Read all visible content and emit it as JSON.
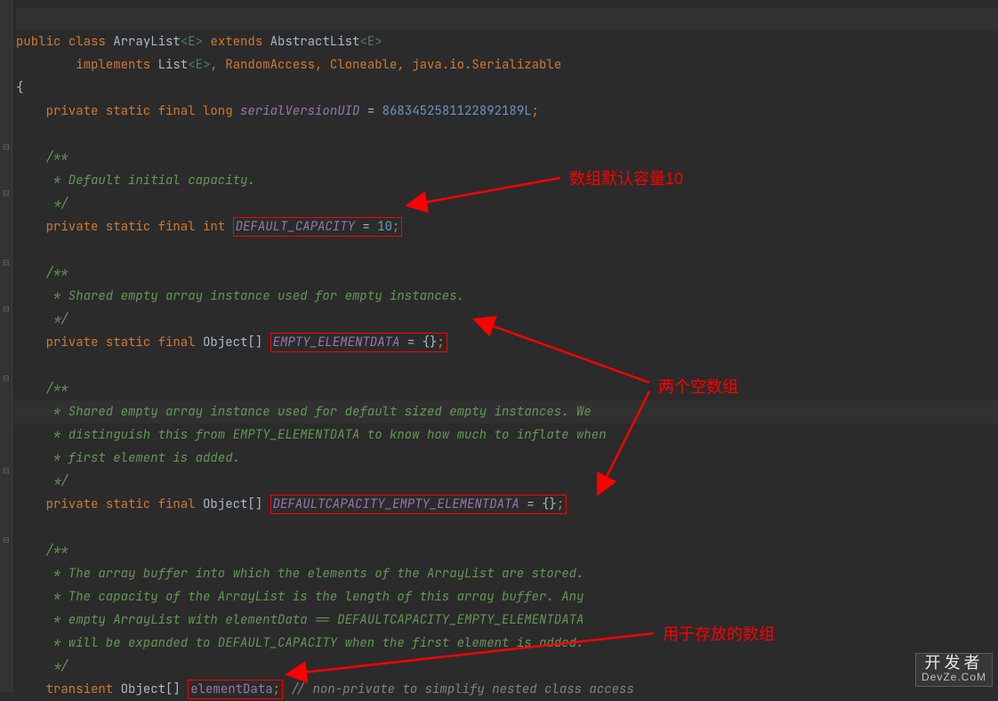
{
  "code": {
    "line1_public": "public",
    "line1_class": "class",
    "line1_name": "ArrayList",
    "line1_gen1": "<E>",
    "line1_extends": "extends",
    "line1_super": "AbstractList",
    "line1_gen2": "<E>",
    "line2_impl": "implements",
    "line2_list": "List",
    "line2_gen": "<E>",
    "line2_rest": ", RandomAccess, Cloneable, java.io.Serializable",
    "line3": "{",
    "line4_mods": "private static final long",
    "line4_name": "serialVersionUID",
    "line4_eq": " = ",
    "line4_val": "8683452581122892189L",
    "line4_semi": ";",
    "c1_open": "/**",
    "c1_body": " * Default initial capacity.",
    "c1_close": " */",
    "line_dc_mods": "private static final int",
    "line_dc_name": "DEFAULT_CAPACITY",
    "line_dc_eq": " = ",
    "line_dc_val": "10",
    "line_dc_semi": ";",
    "c2_open": "/**",
    "c2_body": " * Shared empty array instance used for empty instances.",
    "c2_close": " */",
    "line_ee_mods": "private static final",
    "line_ee_type": " Object[] ",
    "line_ee_name": "EMPTY_ELEMENTDATA",
    "line_ee_eq": " = {}",
    "line_ee_semi": ";",
    "c3_open": "/**",
    "c3_l1": " * Shared empty array instance used for default sized empty instances. We",
    "c3_l2": " * distinguish this from EMPTY_ELEMENTDATA to know how much to inflate when",
    "c3_l3": " * first element is added.",
    "c3_close": " */",
    "line_de_mods": "private static final",
    "line_de_type": " Object[] ",
    "line_de_name": "DEFAULTCAPACITY_EMPTY_ELEMENTDATA",
    "line_de_eq": " = {}",
    "line_de_semi": ";",
    "c4_open": "/**",
    "c4_l1": " * The array buffer into which the elements of the ArrayList are stored.",
    "c4_l2": " * The capacity of the ArrayList is the length of this array buffer. Any",
    "c4_l3": " * empty ArrayList with elementData == DEFAULTCAPACITY_EMPTY_ELEMENTDATA",
    "c4_l4": " * will be expanded to DEFAULT_CAPACITY when the first element is added.",
    "c4_close": " */",
    "line_ed_mods": "transient",
    "line_ed_type": " Object[] ",
    "line_ed_name": "elementData",
    "line_ed_semi": ";",
    "line_ed_comment": " // non-private to simplify nested class access"
  },
  "annotations": {
    "a1": "数组默认容量10",
    "a2": "两个空数组",
    "a3": "用于存放的数组"
  },
  "watermark": {
    "cn": "开发者",
    "en": "DevZe.CoM"
  }
}
